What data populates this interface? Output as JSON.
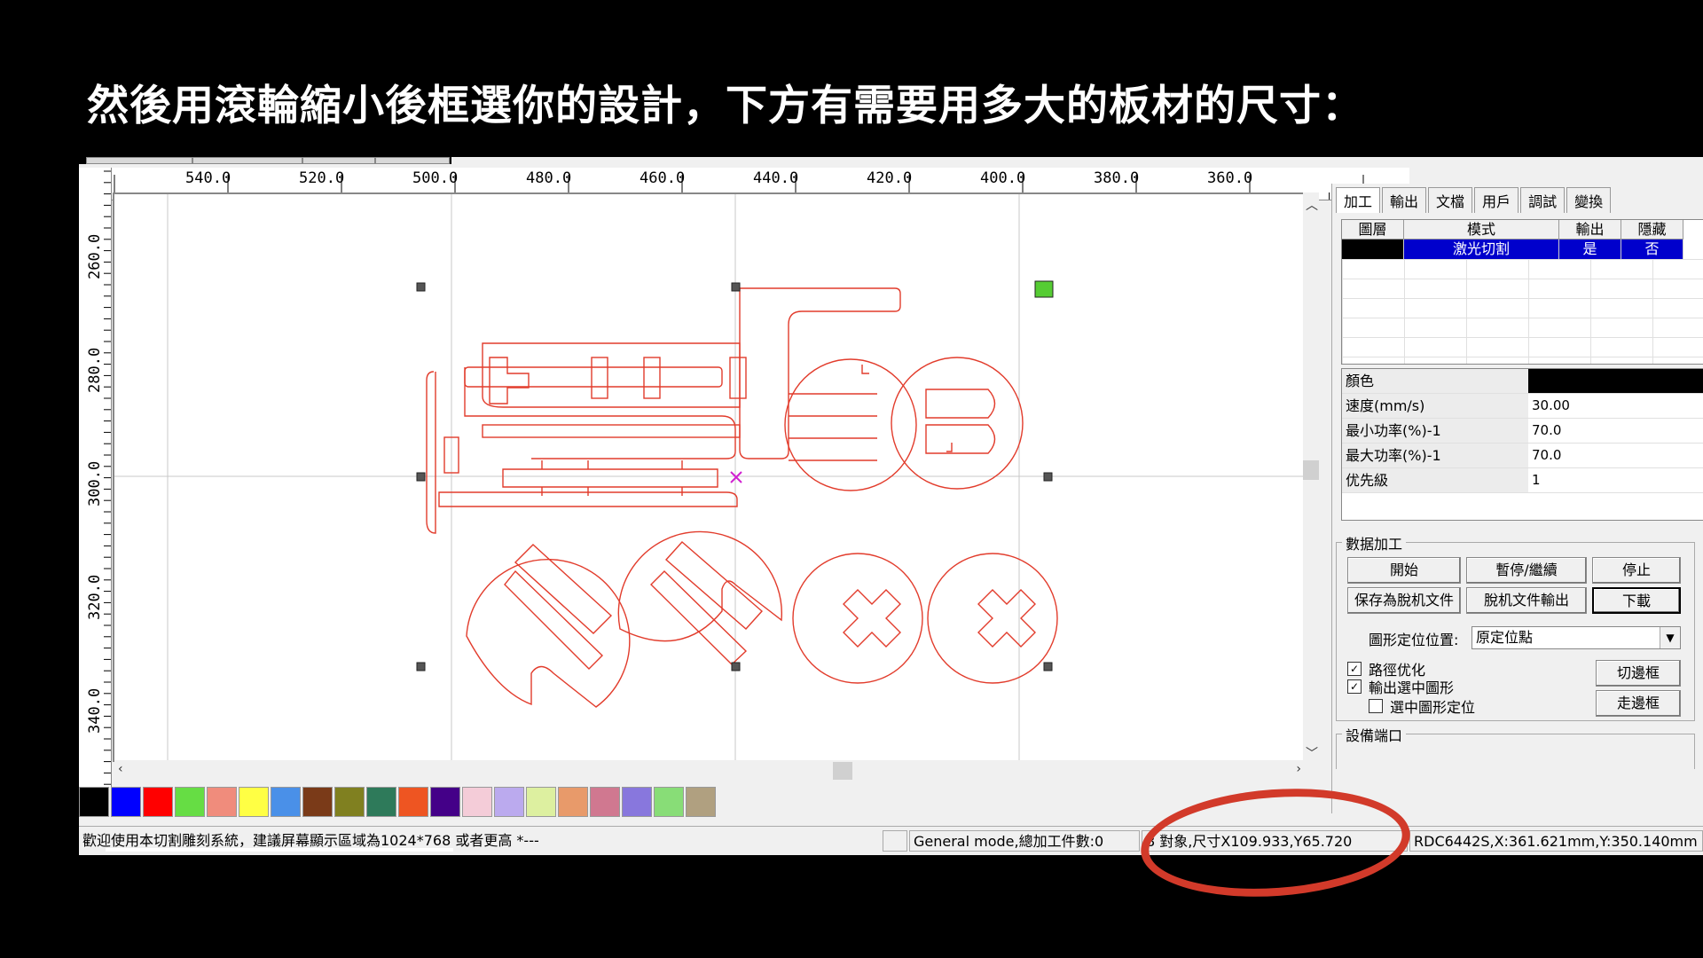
{
  "slide": {
    "title": "然後用滾輪縮小後框選你的設計，下方有需要用多大的板材的尺寸："
  },
  "ruler": {
    "top_labels": [
      "540.0",
      "520.0",
      "500.0",
      "480.0",
      "460.0",
      "440.0",
      "420.0",
      "400.0",
      "380.0",
      "360.0"
    ],
    "left_labels": [
      "260.0",
      "280.0",
      "300.0",
      "320.0",
      "340.0"
    ]
  },
  "palette": {
    "colors": [
      "#000000",
      "#0000ff",
      "#ff0000",
      "#66dd44",
      "#f08c7c",
      "#ffff44",
      "#4a90e8",
      "#7a3a18",
      "#808020",
      "#2e7a5a",
      "#ee5522",
      "#440088",
      "#f4ccd8",
      "#bbaaee",
      "#ddf0a0",
      "#e89a6a",
      "#d07890",
      "#8877dd",
      "#88dd77",
      "#b0a080"
    ]
  },
  "status": {
    "welcome": "歡迎使用本切割雕刻系統，建議屏幕顯示區域為1024*768 或者更高 *---",
    "mode": "General mode,總加工件數:0",
    "selection": "8 對象,尺寸X109.933,Y65.720",
    "device": "RDC6442S,X:361.621mm,Y:350.140mm"
  },
  "panel": {
    "tabs": [
      "加工",
      "輸出",
      "文檔",
      "用戶",
      "調試",
      "變換"
    ],
    "layer_table": {
      "headers": [
        "圖層",
        "模式",
        "輸出",
        "隱藏"
      ],
      "rows": [
        {
          "color": "#000000",
          "mode": "激光切割",
          "output": "是",
          "hidden": "否"
        }
      ]
    },
    "properties": [
      {
        "key": "顏色",
        "value": "",
        "swatch": "#000000"
      },
      {
        "key": "速度(mm/s)",
        "value": "30.00"
      },
      {
        "key": "最小功率(%)-1",
        "value": "70.0"
      },
      {
        "key": "最大功率(%)-1",
        "value": "70.0"
      },
      {
        "key": "优先級",
        "value": "1"
      }
    ],
    "data_processing": {
      "title": "數据加工",
      "start": "開始",
      "pause": "暫停/繼續",
      "stop": "停止",
      "save_offline": "保存為脫机文件",
      "offline_output": "脫机文件輸出",
      "download": "下載",
      "position_label": "圖形定位位置:",
      "position_value": "原定位點",
      "path_opt": "路徑优化",
      "output_selected": "輸出選中圖形",
      "selected_position": "選中圖形定位",
      "cut_border": "切邊框",
      "walk_border": "走邊框"
    },
    "device_port": {
      "title": "設備端口"
    }
  },
  "annotation_color": "#d23a2a",
  "cut_color": "#e23c2c"
}
